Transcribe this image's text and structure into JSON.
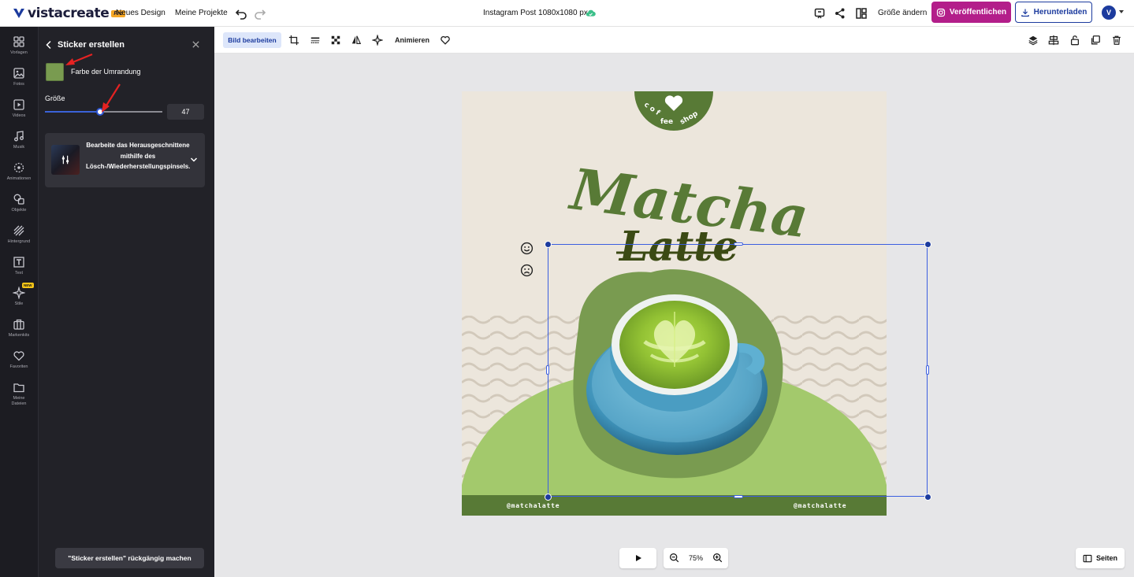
{
  "app": {
    "brand": "vistacreate",
    "pro_badge": "Pro",
    "nav": {
      "new_design": "Neues Design",
      "my_projects": "Meine Projekte"
    },
    "doc_title": "Instagram Post 1080x1080 px",
    "resize": "Größe ändern",
    "publish": "Veröffentlichen",
    "download": "Herunterladen",
    "avatar_initial": "V"
  },
  "rail": {
    "items": [
      {
        "label": "Vorlagen",
        "icon": "templates-icon"
      },
      {
        "label": "Fotos",
        "icon": "photos-icon"
      },
      {
        "label": "Videos",
        "icon": "videos-icon"
      },
      {
        "label": "Musik",
        "icon": "music-icon"
      },
      {
        "label": "Animationen",
        "icon": "animations-icon"
      },
      {
        "label": "Objekte",
        "icon": "objects-icon"
      },
      {
        "label": "Hintergrund",
        "icon": "background-icon"
      },
      {
        "label": "Text",
        "icon": "text-icon"
      },
      {
        "label": "Stile",
        "icon": "styles-icon",
        "badge": "NEW"
      },
      {
        "label": "Markenkits",
        "icon": "brandkits-icon"
      },
      {
        "label": "Favoriten",
        "icon": "favorites-icon"
      },
      {
        "label": "Meine Dateien",
        "icon": "myfiles-icon"
      }
    ]
  },
  "panel": {
    "title": "Sticker erstellen",
    "outline_color_label": "Farbe der Umrandung",
    "outline_color": "#799b50",
    "size_label": "Größe",
    "size_value": "47",
    "size_fraction": 0.47,
    "card_text": "Bearbeite das Herausgeschnittene mithilfe des Lösch-/Wiederherstellungspinsels.",
    "undo_button": "\"Sticker erstellen\" rückgängig machen"
  },
  "toolbar": {
    "edit_image": "Bild bearbeiten",
    "animate": "Animieren"
  },
  "design": {
    "badge_text": "coffee shop",
    "title_line1": "Matcha",
    "title_line2": "Latte",
    "handle_left": "@matchalatte",
    "handle_right": "@matchalatte",
    "colors": {
      "dark_green": "#587a36",
      "light_green": "#a3c96c",
      "cream": "#ece6dc",
      "selection": "#3b5ee0"
    }
  },
  "bottom": {
    "zoom": "75%",
    "pages": "Seiten"
  }
}
